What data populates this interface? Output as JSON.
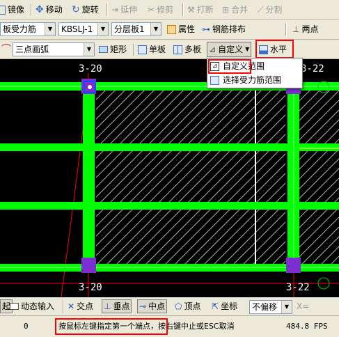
{
  "toolbar1": {
    "mirror": "镜像",
    "move": "移动",
    "rotate": "旋转",
    "extend": "延伸",
    "trim": "修剪",
    "break": "打断",
    "merge": "合并",
    "split": "分割"
  },
  "toolbar2": {
    "type_select": "板受力筋",
    "code_select": "KBSLJ-1",
    "layer_select": "分层板1",
    "properties": "属性",
    "rebar_layout": "钢筋排布",
    "two_points": "两点"
  },
  "toolbar3": {
    "arc_select": "三点画弧",
    "rectangle": "矩形",
    "single_board": "单板",
    "multi_board": "多板",
    "custom": "自定义",
    "horizontal": "水平"
  },
  "dropdown": {
    "items": [
      "自定义范围",
      "选择受力筋范围"
    ]
  },
  "canvas": {
    "labels": [
      "3-20",
      "3-22",
      "3-20",
      "3-22"
    ]
  },
  "snapbar": {
    "partial_left": "起",
    "dynamic_input": "动态输入",
    "intersection": "交点",
    "perpendicular": "垂点",
    "midpoint": "中点",
    "vertex": "顶点",
    "coordinate": "坐标",
    "offset_select": "不偏移",
    "x_label": "X="
  },
  "status": {
    "left_value": "0",
    "prompt": "按鼠标左键指定第一个端点，按右键中止或ESC取消",
    "fps": "484.8 FPS"
  },
  "colors": {
    "beam": "#00ff00",
    "grid_line": "#ff0000",
    "column": "#7b2fd0",
    "background": "#000000",
    "highlight_box": "#ff0000"
  }
}
